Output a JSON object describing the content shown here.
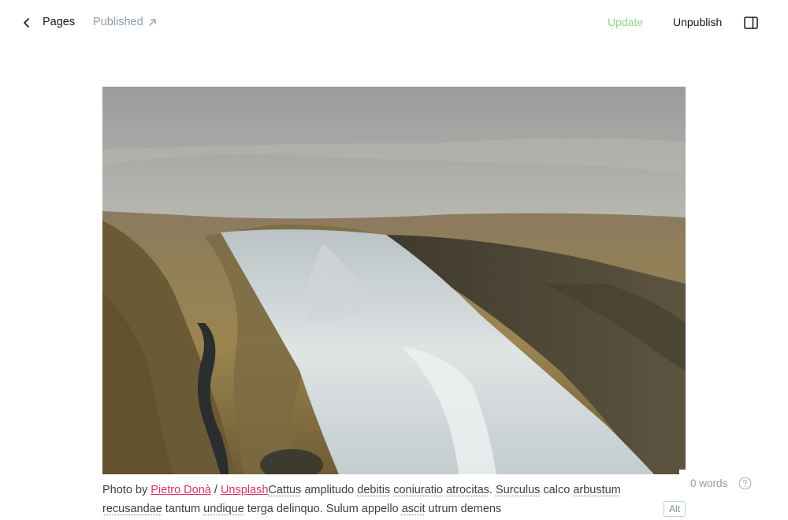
{
  "header": {
    "back_icon": "chevron-left-icon",
    "pages_label": "Pages",
    "status_label": "Published",
    "status_icon": "arrow-up-right-icon",
    "update_label": "Update",
    "update_color": "#8fd48a",
    "unpublish_label": "Unpublish",
    "sidebar_icon": "sidebar-panel-icon"
  },
  "feature_image": {
    "description_icon": "waterfall-photo"
  },
  "caption": {
    "prefix": "Photo by ",
    "author": "Pietro Donà",
    "separator": " / ",
    "source": "Unsplash",
    "words": [
      "Cattus",
      " amplitudo ",
      "debitis",
      " ",
      "coniuratio",
      " ",
      "atrocitas",
      ". ",
      "Surculus",
      " calco ",
      "arbustum",
      " ",
      "recusandae",
      " tantum ",
      "undique",
      " terga delinquo. Sulum appello ",
      "ascit",
      " utrum demens"
    ],
    "link_color": "#d6336c"
  },
  "editor": {
    "word_count": "0 words",
    "help_icon": "question-circle-icon",
    "alt_label": "Alt"
  }
}
